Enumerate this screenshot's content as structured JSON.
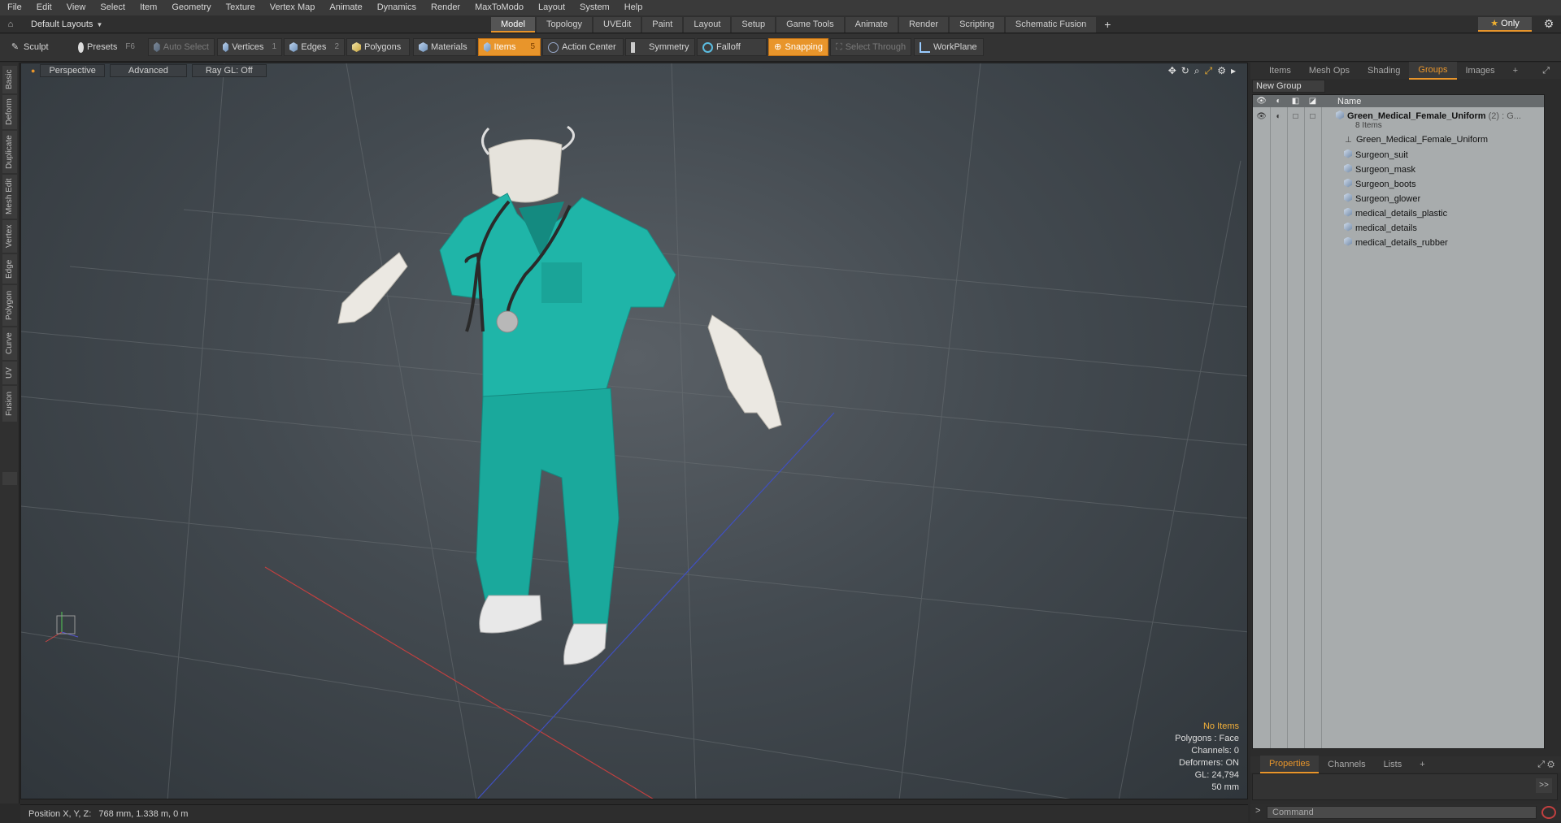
{
  "menubar": [
    "File",
    "Edit",
    "View",
    "Select",
    "Item",
    "Geometry",
    "Texture",
    "Vertex Map",
    "Animate",
    "Dynamics",
    "Render",
    "MaxToModo",
    "Layout",
    "System",
    "Help"
  ],
  "layout_selector": "Default Layouts",
  "tabs": [
    "Model",
    "Topology",
    "UVEdit",
    "Paint",
    "Layout",
    "Setup",
    "Game Tools",
    "Animate",
    "Render",
    "Scripting",
    "Schematic Fusion"
  ],
  "active_tab": "Model",
  "only_label": "Only",
  "toolbar": {
    "sculpt": "Sculpt",
    "presets": "Presets",
    "presets_key": "F6",
    "auto_select": "Auto Select",
    "vertices": "Vertices",
    "vertices_key": "1",
    "edges": "Edges",
    "edges_key": "2",
    "polygons": "Polygons",
    "materials": "Materials",
    "items": "Items",
    "items_key": "5",
    "action_center": "Action Center",
    "symmetry": "Symmetry",
    "falloff": "Falloff",
    "snapping": "Snapping",
    "select_through": "Select Through",
    "workplane": "WorkPlane"
  },
  "left_tabs": [
    "Basic",
    "Deform",
    "Duplicate",
    "Mesh Edit",
    "Vertex",
    "Edge",
    "Polygon",
    "Curve",
    "UV",
    "Fusion"
  ],
  "viewport": {
    "view": "Perspective",
    "shading": "Advanced",
    "raygl": "Ray GL: Off",
    "hud": {
      "selection": "No Items",
      "polygons": "Polygons : Face",
      "channels": "Channels: 0",
      "deformers": "Deformers: ON",
      "gl": "GL: 24,794",
      "scale": "50 mm"
    }
  },
  "status": "Position X, Y, Z:   768 mm, 1.338 m, 0 m",
  "right_panel": {
    "tabs": [
      "Items",
      "Mesh Ops",
      "Shading",
      "Groups",
      "Images"
    ],
    "active_tab": "Groups",
    "new_group": "New Group",
    "name_header": "Name",
    "group": {
      "name": "Green_Medical_Female_Uniform",
      "suffix": "(2) : G...",
      "count": "8 Items"
    },
    "items": [
      "Green_Medical_Female_Uniform",
      "Surgeon_suit",
      "Surgeon_mask",
      "Surgeon_boots",
      "Surgeon_glower",
      "medical_details_plastic",
      "medical_details",
      "medical_details_rubber"
    ],
    "bottom_tabs": [
      "Properties",
      "Channels",
      "Lists"
    ],
    "bottom_active": "Properties",
    "command_placeholder": "Command"
  },
  "colors": {
    "accent": "#e8952b",
    "scrubs": "#1fb5a8",
    "viewport_bg": "#434a50"
  }
}
